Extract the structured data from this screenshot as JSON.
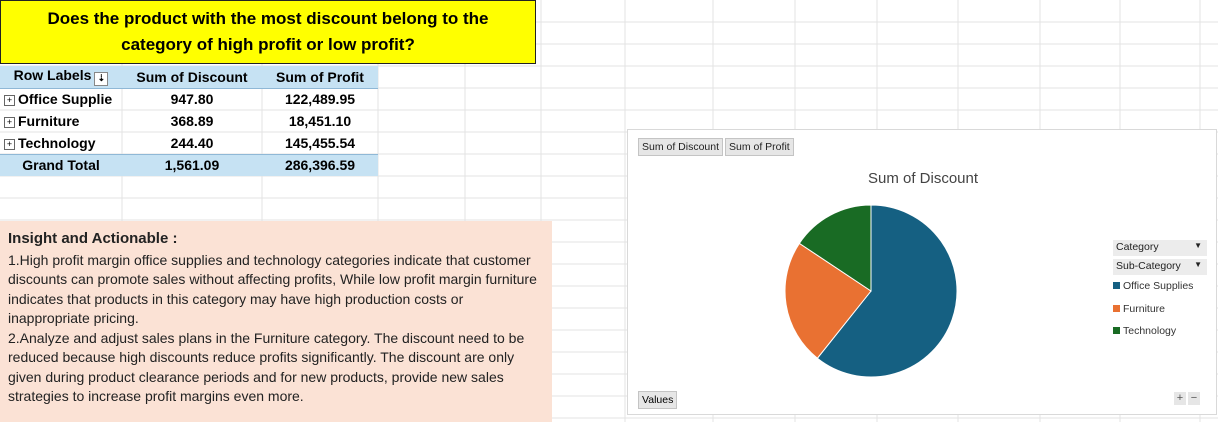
{
  "question": {
    "line1": "Does the product with the most discount belong to the",
    "line2": "category of high profit or low profit?"
  },
  "pivot": {
    "headers": [
      "Row Labels",
      "Sum of Discount",
      "Sum of Profit"
    ],
    "rows": [
      {
        "label": "Office Supplie",
        "discount": "947.80",
        "profit": "122,489.95"
      },
      {
        "label": "Furniture",
        "discount": "368.89",
        "profit": "18,451.10"
      },
      {
        "label": "Technology",
        "discount": "244.40",
        "profit": "145,455.54"
      }
    ],
    "total": {
      "label": "Grand Total",
      "discount": "1,561.09",
      "profit": "286,396.59"
    }
  },
  "insight": {
    "heading": "Insight and Actionable :",
    "p1": "1.High profit margin office supplies and technology categories indicate that customer discounts can promote sales without affecting profits, While low profit margin furniture indicates that products in this category may have high production costs or inappropriate pricing.",
    "p2": "2.Analyze and adjust sales plans in the Furniture category. The discount need to be reduced because high discounts reduce profits significantly. The discount are only given during product clearance periods and for new products, provide new sales strategies to increase profit margins even more."
  },
  "chart": {
    "field_buttons": [
      "Sum of Discount",
      "Sum of Profit"
    ],
    "values_button": "Values",
    "category_filter": "Category",
    "subcategory_filter": "Sub-Category",
    "plus": "+",
    "minus": "−"
  },
  "chart_data": {
    "type": "pie",
    "title": "Sum of Discount",
    "categories": [
      "Office Supplies",
      "Furniture",
      "Technology"
    ],
    "values": [
      947.8,
      368.89,
      244.4
    ],
    "colors": [
      "#156082",
      "#e97132",
      "#196b24"
    ],
    "legend": "right"
  }
}
